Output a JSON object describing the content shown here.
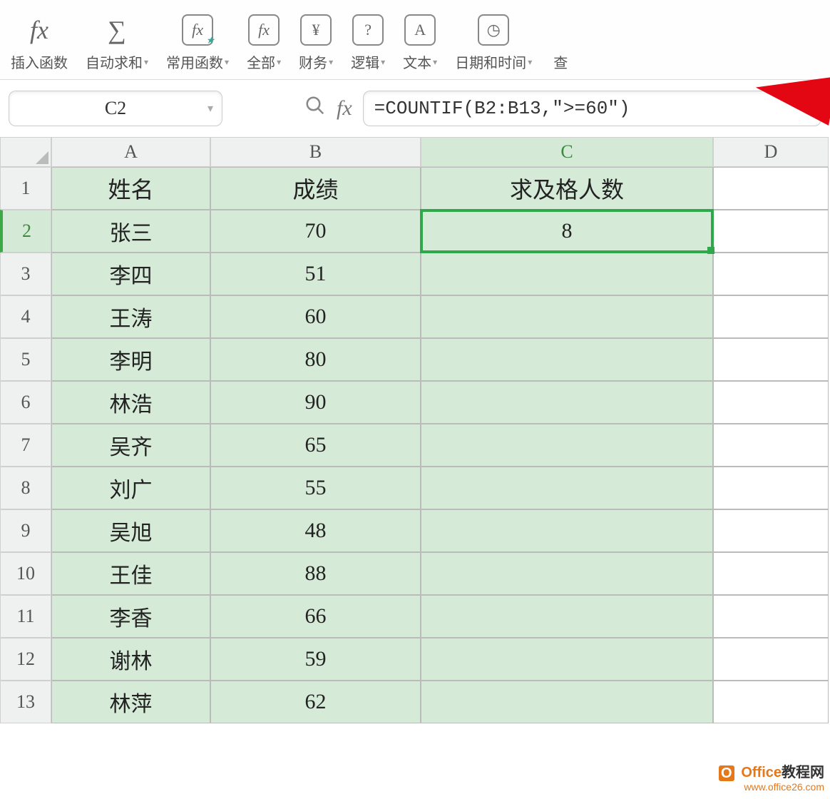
{
  "ribbon": {
    "insert_fn": "插入函数",
    "autosum": "自动求和",
    "common_fn": "常用函数",
    "all": "全部",
    "financial": "财务",
    "logical": "逻辑",
    "text": "文本",
    "datetime": "日期和时间",
    "lookup": "查"
  },
  "name_box": "C2",
  "formula": "=COUNTIF(B2:B13,\">=60\")",
  "columns": [
    "A",
    "B",
    "C",
    "D"
  ],
  "row_numbers": [
    "1",
    "2",
    "3",
    "4",
    "5",
    "6",
    "7",
    "8",
    "9",
    "10",
    "11",
    "12",
    "13"
  ],
  "headers": {
    "A": "姓名",
    "B": "成绩",
    "C": "求及格人数"
  },
  "data": [
    {
      "A": "张三",
      "B": "70",
      "C": "8"
    },
    {
      "A": "李四",
      "B": "51",
      "C": ""
    },
    {
      "A": "王涛",
      "B": "60",
      "C": ""
    },
    {
      "A": "李明",
      "B": "80",
      "C": ""
    },
    {
      "A": "林浩",
      "B": "90",
      "C": ""
    },
    {
      "A": "吴齐",
      "B": "65",
      "C": ""
    },
    {
      "A": "刘广",
      "B": "55",
      "C": ""
    },
    {
      "A": "吴旭",
      "B": "48",
      "C": ""
    },
    {
      "A": "王佳",
      "B": "88",
      "C": ""
    },
    {
      "A": "李香",
      "B": "66",
      "C": ""
    },
    {
      "A": "谢林",
      "B": "59",
      "C": ""
    },
    {
      "A": "林萍",
      "B": "62",
      "C": ""
    }
  ],
  "selected_cell": "C2",
  "watermark": {
    "line1a": "Office",
    "line1b": "教程网",
    "line2": "www.office26.com"
  }
}
